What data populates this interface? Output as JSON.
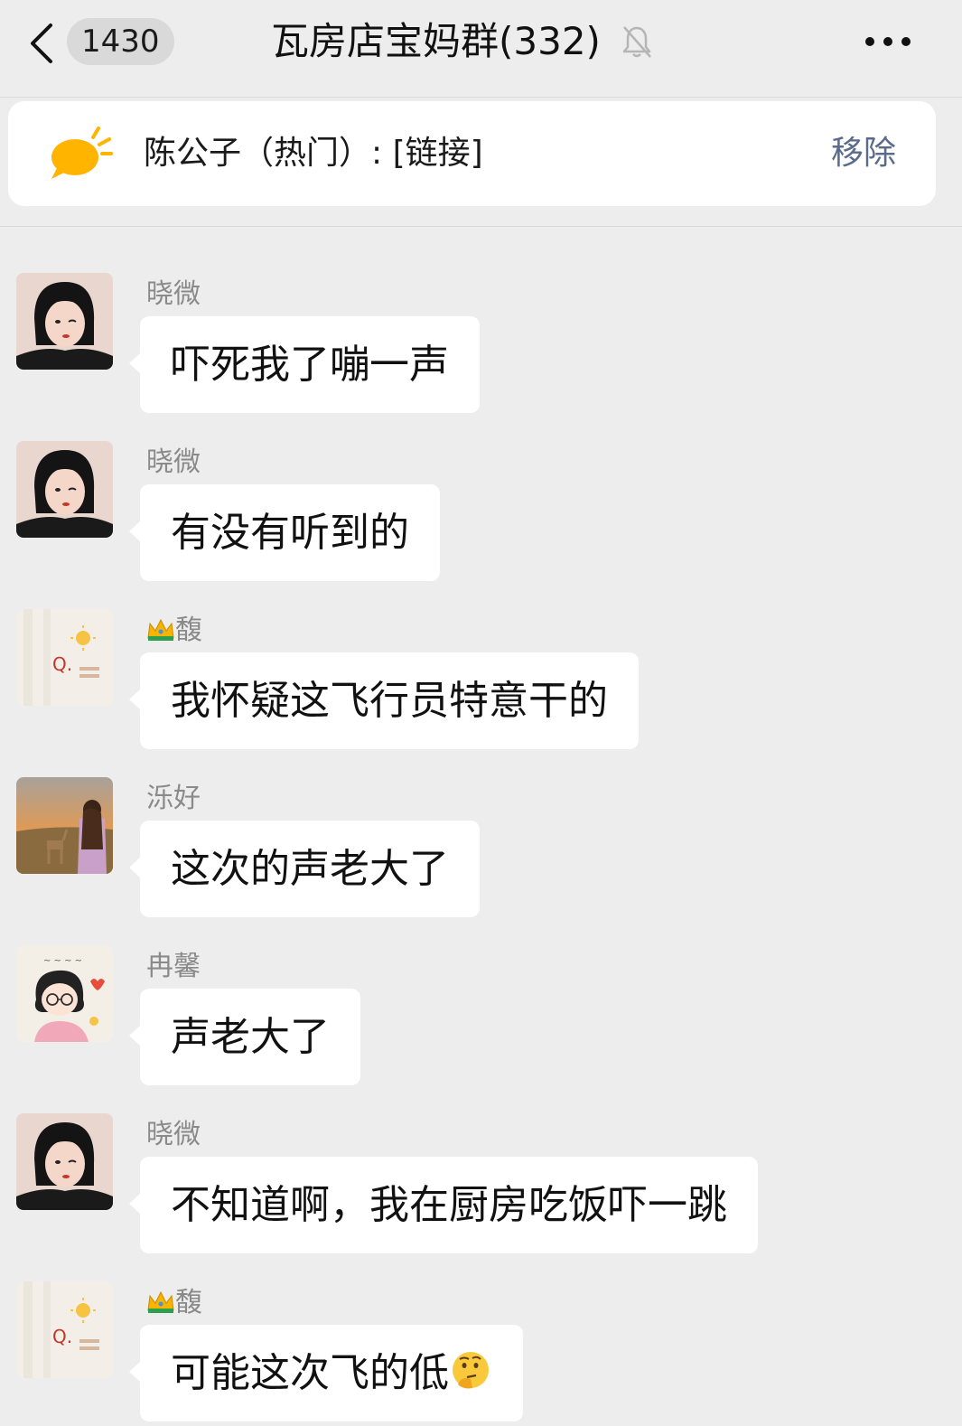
{
  "header": {
    "unread_count": "1430",
    "title": "瓦房店宝妈群(332)"
  },
  "pinned": {
    "text": "陈公子（热门）: [链接]",
    "remove_label": "移除"
  },
  "messages": [
    {
      "sender": "晓微",
      "text": "吓死我了嘣一声",
      "avatar": "girl-bob-avatar"
    },
    {
      "sender": "晓微",
      "text": "有没有听到的",
      "avatar": "girl-bob-avatar"
    },
    {
      "sender": "馥",
      "sender_prefix_icon": "crown-icon",
      "text": "我怀疑这飞行员特意干的",
      "avatar": "sun-letter-avatar"
    },
    {
      "sender": "泺好",
      "text": "这次的声老大了",
      "avatar": "sunset-deer-avatar"
    },
    {
      "sender": "冉馨",
      "text": "声老大了",
      "avatar": "cartoon-girl-glasses-avatar"
    },
    {
      "sender": "晓微",
      "text": "不知道啊，我在厨房吃饭吓一跳",
      "avatar": "girl-bob-avatar"
    },
    {
      "sender": "馥",
      "sender_prefix_icon": "crown-icon",
      "text": "可能这次飞的低",
      "text_suffix_icon": "thinking-face-emoji",
      "avatar": "sun-letter-avatar"
    }
  ],
  "colors": {
    "background": "#ededed",
    "bubble": "#ffffff",
    "remove_link": "#5a6b8c",
    "sender_name": "#8a8a8a"
  }
}
